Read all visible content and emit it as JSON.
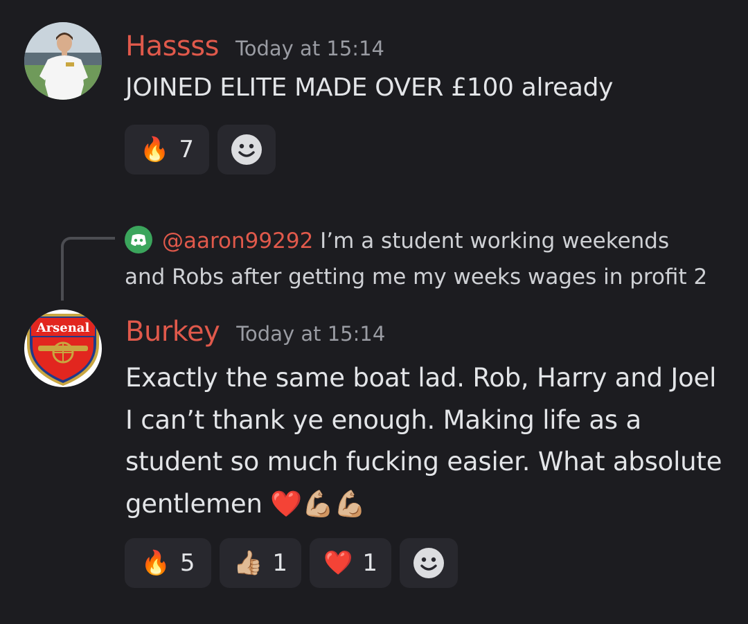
{
  "messages": [
    {
      "username": "Hassss",
      "timestamp": "Today at 15:14",
      "text": "JOINED ELITE MADE OVER £100 already",
      "avatar_icon": "footballer-avatar",
      "reactions": [
        {
          "emoji": "fire",
          "glyph": "🔥",
          "count": "7"
        },
        {
          "emoji": "add-reaction",
          "glyph": "☺"
        }
      ]
    },
    {
      "reply": {
        "mention": "@aaron99292",
        "line1": " I’m a student working weekends",
        "line2": "and Robs after getting me my weeks wages in profit 2"
      },
      "username": "Burkey",
      "timestamp": "Today at 15:14",
      "avatar_icon": "arsenal-crest-avatar",
      "avatar_label": "Arsenal",
      "lines": [
        "Exactly the same boat lad. Rob, Harry and Joel",
        "I can’t thank ye enough. Making life as a",
        "student so much fucking easier. What absolute",
        "gentlemen ❤️💪🏼💪🏼"
      ],
      "reactions": [
        {
          "emoji": "fire",
          "glyph": "🔥",
          "count": "5"
        },
        {
          "emoji": "thumbs-up",
          "glyph": "👍🏼",
          "count": "1"
        },
        {
          "emoji": "heart",
          "glyph": "❤️",
          "count": "1"
        },
        {
          "emoji": "add-reaction",
          "glyph": "☺"
        }
      ]
    }
  ],
  "colors": {
    "background": "#1c1c20",
    "username": "#e0594b",
    "timestamp": "#9a9ca3",
    "reaction_bg": "#28282e"
  }
}
